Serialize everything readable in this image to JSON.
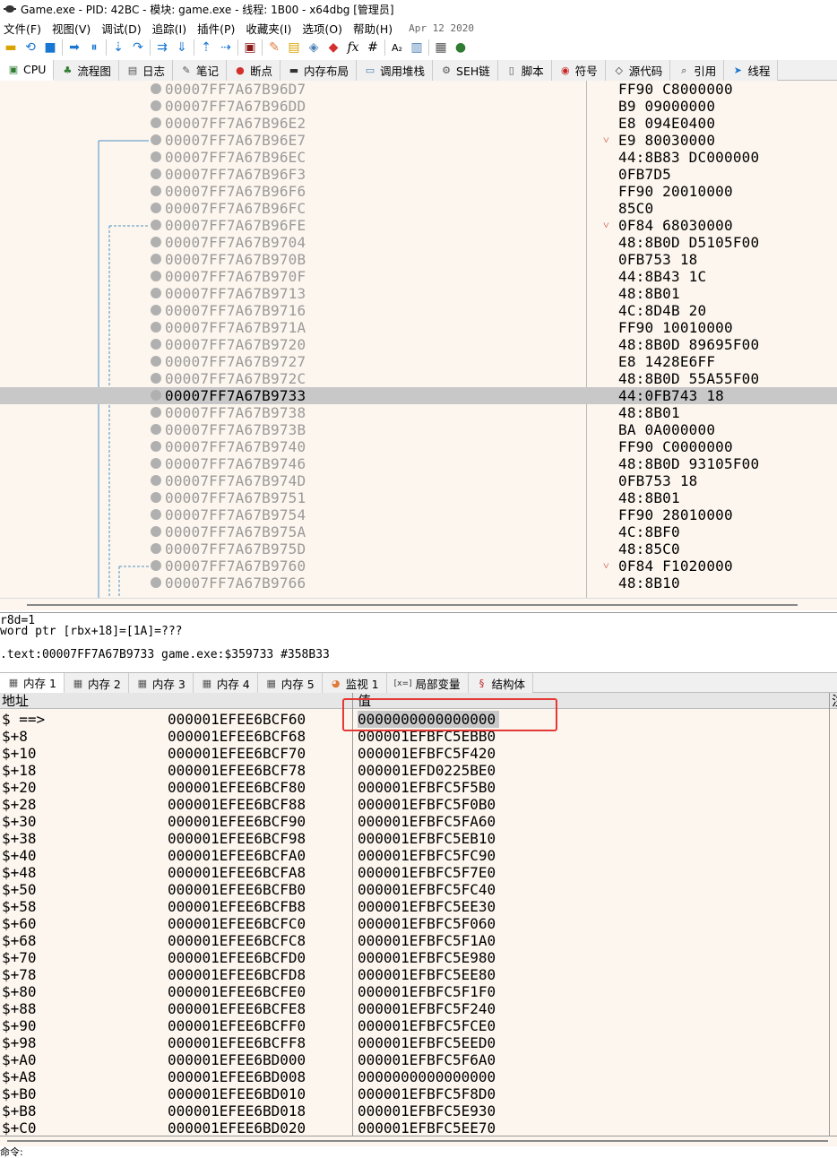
{
  "window": {
    "title": "Game.exe - PID: 42BC - 模块: game.exe - 线程: 1B00 - x64dbg [管理员]"
  },
  "menu": {
    "items": [
      "文件(F)",
      "视图(V)",
      "调试(D)",
      "追踪(I)",
      "插件(P)",
      "收藏夹(I)",
      "选项(O)",
      "帮助(H)"
    ],
    "date": "Apr 12 2020"
  },
  "toolbar": {
    "icons": [
      "open-icon",
      "restart-icon",
      "stop-icon",
      "run-icon",
      "pause-icon",
      "step-into-icon",
      "step-over-icon",
      "trace-into-icon",
      "trace-over-icon",
      "execute-till-return-icon",
      "run-to-user-code-icon",
      "scylla-icon",
      "patch-icon",
      "comment-icon",
      "label-icon",
      "bookmark-icon",
      "function-icon",
      "hash-icon",
      "strings-icon",
      "settings-icon",
      "calculator-icon",
      "globe-icon"
    ],
    "fx": "fx",
    "hash": "#"
  },
  "top_tabs": [
    {
      "label": "CPU",
      "icon": "cpu-icon"
    },
    {
      "label": "流程图",
      "icon": "tree-icon"
    },
    {
      "label": "日志",
      "icon": "log-icon"
    },
    {
      "label": "笔记",
      "icon": "notes-icon"
    },
    {
      "label": "断点",
      "icon": "breakpoint-icon"
    },
    {
      "label": "内存布局",
      "icon": "memory-map-icon"
    },
    {
      "label": "调用堆栈",
      "icon": "callstack-icon"
    },
    {
      "label": "SEH链",
      "icon": "seh-icon"
    },
    {
      "label": "脚本",
      "icon": "script-icon"
    },
    {
      "label": "符号",
      "icon": "symbol-icon"
    },
    {
      "label": "源代码",
      "icon": "source-icon"
    },
    {
      "label": "引用",
      "icon": "references-icon"
    },
    {
      "label": "线程",
      "icon": "threads-icon"
    }
  ],
  "disasm": {
    "rows": [
      {
        "addr": "00007FF7A67B96D7",
        "bytes": "FF90 C8000000",
        "arrow": ""
      },
      {
        "addr": "00007FF7A67B96DD",
        "bytes": "B9 09000000",
        "arrow": ""
      },
      {
        "addr": "00007FF7A67B96E2",
        "bytes": "E8 094E0400",
        "arrow": ""
      },
      {
        "addr": "00007FF7A67B96E7",
        "bytes": "E9 80030000",
        "arrow": "˅"
      },
      {
        "addr": "00007FF7A67B96EC",
        "bytes": "44:8B83 DC000000",
        "arrow": ""
      },
      {
        "addr": "00007FF7A67B96F3",
        "bytes": "0FB7D5",
        "arrow": ""
      },
      {
        "addr": "00007FF7A67B96F6",
        "bytes": "FF90 20010000",
        "arrow": ""
      },
      {
        "addr": "00007FF7A67B96FC",
        "bytes": "85C0",
        "arrow": ""
      },
      {
        "addr": "00007FF7A67B96FE",
        "bytes": "0F84 68030000",
        "arrow": "˅"
      },
      {
        "addr": "00007FF7A67B9704",
        "bytes": "48:8B0D D5105F00",
        "arrow": ""
      },
      {
        "addr": "00007FF7A67B970B",
        "bytes": "0FB753 18",
        "arrow": ""
      },
      {
        "addr": "00007FF7A67B970F",
        "bytes": "44:8B43 1C",
        "arrow": ""
      },
      {
        "addr": "00007FF7A67B9713",
        "bytes": "48:8B01",
        "arrow": ""
      },
      {
        "addr": "00007FF7A67B9716",
        "bytes": "4C:8D4B 20",
        "arrow": ""
      },
      {
        "addr": "00007FF7A67B971A",
        "bytes": "FF90 10010000",
        "arrow": ""
      },
      {
        "addr": "00007FF7A67B9720",
        "bytes": "48:8B0D 89695F00",
        "arrow": ""
      },
      {
        "addr": "00007FF7A67B9727",
        "bytes": "E8 1428E6FF",
        "arrow": ""
      },
      {
        "addr": "00007FF7A67B972C",
        "bytes": "48:8B0D 55A55F00",
        "arrow": ""
      },
      {
        "addr": "00007FF7A67B9733",
        "bytes": "44:0FB743 18",
        "arrow": "",
        "selected": true
      },
      {
        "addr": "00007FF7A67B9738",
        "bytes": "48:8B01",
        "arrow": ""
      },
      {
        "addr": "00007FF7A67B973B",
        "bytes": "BA 0A000000",
        "arrow": ""
      },
      {
        "addr": "00007FF7A67B9740",
        "bytes": "FF90 C0000000",
        "arrow": ""
      },
      {
        "addr": "00007FF7A67B9746",
        "bytes": "48:8B0D 93105F00",
        "arrow": ""
      },
      {
        "addr": "00007FF7A67B974D",
        "bytes": "0FB753 18",
        "arrow": ""
      },
      {
        "addr": "00007FF7A67B9751",
        "bytes": "48:8B01",
        "arrow": ""
      },
      {
        "addr": "00007FF7A67B9754",
        "bytes": "FF90 28010000",
        "arrow": ""
      },
      {
        "addr": "00007FF7A67B975A",
        "bytes": "4C:8BF0",
        "arrow": ""
      },
      {
        "addr": "00007FF7A67B975D",
        "bytes": "48:85C0",
        "arrow": ""
      },
      {
        "addr": "00007FF7A67B9760",
        "bytes": "0F84 F1020000",
        "arrow": "˅"
      },
      {
        "addr": "00007FF7A67B9766",
        "bytes": "48:8B10",
        "arrow": ""
      }
    ]
  },
  "info": {
    "line1": "r8d=1",
    "line2": "word ptr [rbx+18]=[1A]=???",
    "line3": ".text:00007FF7A67B9733 game.exe:$359733 #358B33"
  },
  "bottom_tabs": [
    {
      "label": "内存 1",
      "icon": "memory-icon"
    },
    {
      "label": "内存 2",
      "icon": "memory-icon"
    },
    {
      "label": "内存 3",
      "icon": "memory-icon"
    },
    {
      "label": "内存 4",
      "icon": "memory-icon"
    },
    {
      "label": "内存 5",
      "icon": "memory-icon"
    },
    {
      "label": "监视 1",
      "icon": "watch-icon"
    },
    {
      "label": "局部变量",
      "icon": "locals-icon",
      "prefix": "[x=]"
    },
    {
      "label": "结构体",
      "icon": "struct-icon"
    }
  ],
  "dump": {
    "headers": {
      "addr": "地址",
      "value": "值",
      "comment": "注"
    },
    "rows": [
      {
        "off": "$ ==>",
        "addr": "000001EFEE6BCF60",
        "val": "0000000000000000",
        "sel": true
      },
      {
        "off": "$+8",
        "addr": "000001EFEE6BCF68",
        "val": "000001EFBFC5EBB0"
      },
      {
        "off": "$+10",
        "addr": "000001EFEE6BCF70",
        "val": "000001EFBFC5F420"
      },
      {
        "off": "$+18",
        "addr": "000001EFEE6BCF78",
        "val": "000001EFD0225BE0"
      },
      {
        "off": "$+20",
        "addr": "000001EFEE6BCF80",
        "val": "000001EFBFC5F5B0"
      },
      {
        "off": "$+28",
        "addr": "000001EFEE6BCF88",
        "val": "000001EFBFC5F0B0"
      },
      {
        "off": "$+30",
        "addr": "000001EFEE6BCF90",
        "val": "000001EFBFC5FA60"
      },
      {
        "off": "$+38",
        "addr": "000001EFEE6BCF98",
        "val": "000001EFBFC5EB10"
      },
      {
        "off": "$+40",
        "addr": "000001EFEE6BCFA0",
        "val": "000001EFBFC5FC90"
      },
      {
        "off": "$+48",
        "addr": "000001EFEE6BCFA8",
        "val": "000001EFBFC5F7E0"
      },
      {
        "off": "$+50",
        "addr": "000001EFEE6BCFB0",
        "val": "000001EFBFC5FC40"
      },
      {
        "off": "$+58",
        "addr": "000001EFEE6BCFB8",
        "val": "000001EFBFC5EE30"
      },
      {
        "off": "$+60",
        "addr": "000001EFEE6BCFC0",
        "val": "000001EFBFC5F060"
      },
      {
        "off": "$+68",
        "addr": "000001EFEE6BCFC8",
        "val": "000001EFBFC5F1A0"
      },
      {
        "off": "$+70",
        "addr": "000001EFEE6BCFD0",
        "val": "000001EFBFC5E980"
      },
      {
        "off": "$+78",
        "addr": "000001EFEE6BCFD8",
        "val": "000001EFBFC5EE80"
      },
      {
        "off": "$+80",
        "addr": "000001EFEE6BCFE0",
        "val": "000001EFBFC5F1F0"
      },
      {
        "off": "$+88",
        "addr": "000001EFEE6BCFE8",
        "val": "000001EFBFC5F240"
      },
      {
        "off": "$+90",
        "addr": "000001EFEE6BCFF0",
        "val": "000001EFBFC5FCE0"
      },
      {
        "off": "$+98",
        "addr": "000001EFEE6BCFF8",
        "val": "000001EFBFC5EED0"
      },
      {
        "off": "$+A0",
        "addr": "000001EFEE6BD000",
        "val": "000001EFBFC5F6A0"
      },
      {
        "off": "$+A8",
        "addr": "000001EFEE6BD008",
        "val": "0000000000000000"
      },
      {
        "off": "$+B0",
        "addr": "000001EFEE6BD010",
        "val": "000001EFBFC5F8D0"
      },
      {
        "off": "$+B8",
        "addr": "000001EFEE6BD018",
        "val": "000001EFBFC5E930"
      },
      {
        "off": "$+C0",
        "addr": "000001EFEE6BD020",
        "val": "000001EFBFC5EE70"
      }
    ]
  },
  "cmd": {
    "label": "命令:"
  },
  "colors": {
    "panel_bg": "#fdf6ee",
    "selection": "#c8c8c8",
    "annotation_red": "#e53935",
    "arrow_red": "#c0392b"
  }
}
